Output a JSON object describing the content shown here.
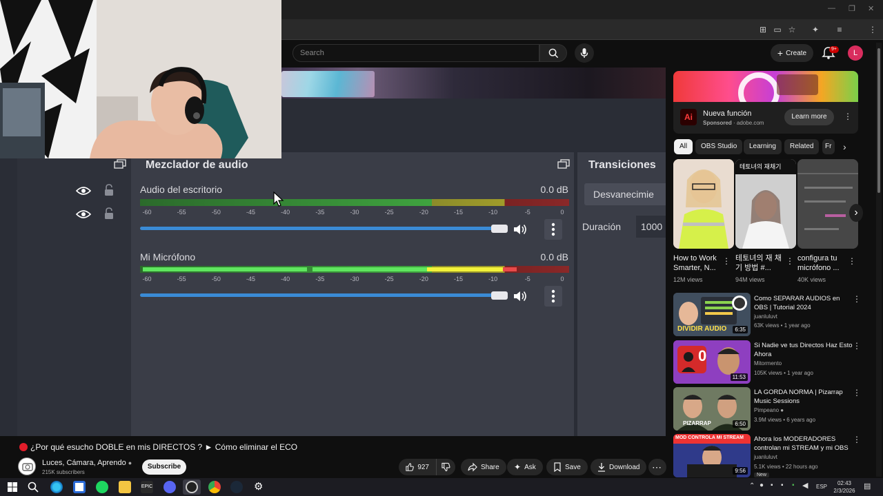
{
  "browser": {
    "profile_initial": "L"
  },
  "youtube": {
    "search_placeholder": "Search",
    "create_label": "Create",
    "notif_badge": "9+",
    "avatar_initial": "L"
  },
  "obs": {
    "mixer_title": "Mezclador de audio",
    "channels": [
      {
        "name": "Audio del escritorio",
        "db": "0.0 dB"
      },
      {
        "name": "Mi Micrófono",
        "db": "0.0 dB"
      }
    ],
    "ticks": [
      "-60",
      "-55",
      "-50",
      "-45",
      "-40",
      "-35",
      "-30",
      "-25",
      "-20",
      "-15",
      "-10",
      "-5",
      "0"
    ],
    "transitions_title": "Transiciones",
    "transition_value": "Desvanecimie",
    "duration_label": "Duración",
    "duration_value": "1000"
  },
  "video": {
    "title": "¿Por qué esucho DOBLE en mis DIRECTOS ? ► Cómo eliminar el ECO",
    "channel_name": "Luces, Cámara, Aprendo",
    "channel_subs": "215K subscribers",
    "subscribe_label": "Subscribe",
    "like_count": "927",
    "share_label": "Share",
    "ask_label": "Ask",
    "save_label": "Save",
    "download_label": "Download"
  },
  "ad": {
    "logo_text": "Ai",
    "title": "Nueva función",
    "sponsored": "Sponsored",
    "domain": "adobe.com",
    "cta": "Learn more"
  },
  "chips": [
    "All",
    "OBS Studio",
    "Learning",
    "Related",
    "Fr"
  ],
  "shorts": [
    {
      "title": "How to Work Smarter, N...",
      "views": "12M views"
    },
    {
      "title": "테토녀의 재 채기 방법 #...",
      "views": "94M views",
      "overlay": "테토녀의 재채기"
    },
    {
      "title": "configura tu micrófono ...",
      "views": "40K views"
    }
  ],
  "recommendations": [
    {
      "title": "Como SEPARAR AUDIOS en OBS | Tutorial 2024",
      "channel": "juanluluvt",
      "meta": "63K views • 1 year ago",
      "duration": "6:35",
      "thumb_text": "DIVIDIR AUDIO"
    },
    {
      "title": "Si Nadie ve tus Directos Haz Esto Ahora",
      "channel": "Mitormento",
      "meta": "105K views • 1 year ago",
      "duration": "11:53",
      "thumb_text": "0"
    },
    {
      "title": "LA GORDA NORMA | Pizarrap Music Sessions",
      "channel": "Pimpeano",
      "meta": "3.9M views • 6 years ago",
      "duration": "6:50",
      "thumb_text": "PIZARRAP"
    },
    {
      "title": "Ahora los MODERADORES controlan mi STREAM y mi OBS",
      "channel": "juanluluvt",
      "meta": "5.1K views • 22 hours ago",
      "duration": "9:56",
      "thumb_text": "MOD CONTROLA MI STREAM",
      "badge": "New"
    }
  ],
  "taskbar": {
    "lang": "ESP",
    "time": "02:43",
    "date": "2/3/2026"
  },
  "colors": {
    "accent_red": "#e11d2a",
    "obs_bg": "#3a3d47",
    "meter_green": "#3fa33f",
    "slider_blue": "#3a8bd6"
  }
}
